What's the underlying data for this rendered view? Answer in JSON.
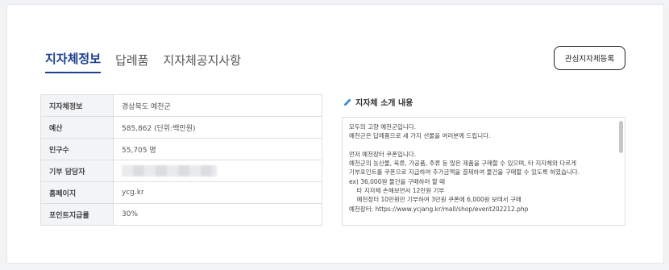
{
  "tabs": [
    {
      "label": "지자체정보",
      "active": true
    },
    {
      "label": "답례품",
      "active": false
    },
    {
      "label": "지자체공지사항",
      "active": false
    }
  ],
  "favorite_button": "관심지자체등록",
  "info_table": {
    "rows": [
      {
        "label": "지자체정보",
        "value": "경상북도 예천군"
      },
      {
        "label": "예산",
        "value": "585,862 (단위:백만원)"
      },
      {
        "label": "인구수",
        "value": "55,705 명"
      },
      {
        "label": "기부 담당자",
        "value": ""
      },
      {
        "label": "홈페이지",
        "value": "ycg.kr"
      },
      {
        "label": "포인트지급률",
        "value": "30%"
      }
    ]
  },
  "intro": {
    "title": "지자체 소개 내용",
    "text": "모두의 고향 예천군입니다.\n예천군은 답례품으로 세 가지 선물을 여러분께 드립니다.\n\n먼저 예천장터 쿠폰입니다.\n예천군의 농산물, 육류, 가공품, 주류 등 많은 제품을 구매할 수 있으며, 타 지자체와 다르게\n기부포인트를 쿠폰으로 지급하여 추가금액을 결제하여 물건을 구매할 수 있도록 하였습니다.\nex) 36,000원 물건을 구매하려 할 때\n    타 지자체 손해보면서 12만원 기부\n    예천장터 10만원만 기부하여 3만원 쿠폰에 6,000원 보태서 구매\n예천장터: https://www.ycjang.kr/mall/shop/event202212.php"
  },
  "colors": {
    "accent": "#1c3f8f",
    "pencil": "#3a8fd9"
  },
  "icons": {
    "intro": "pencil-icon"
  }
}
